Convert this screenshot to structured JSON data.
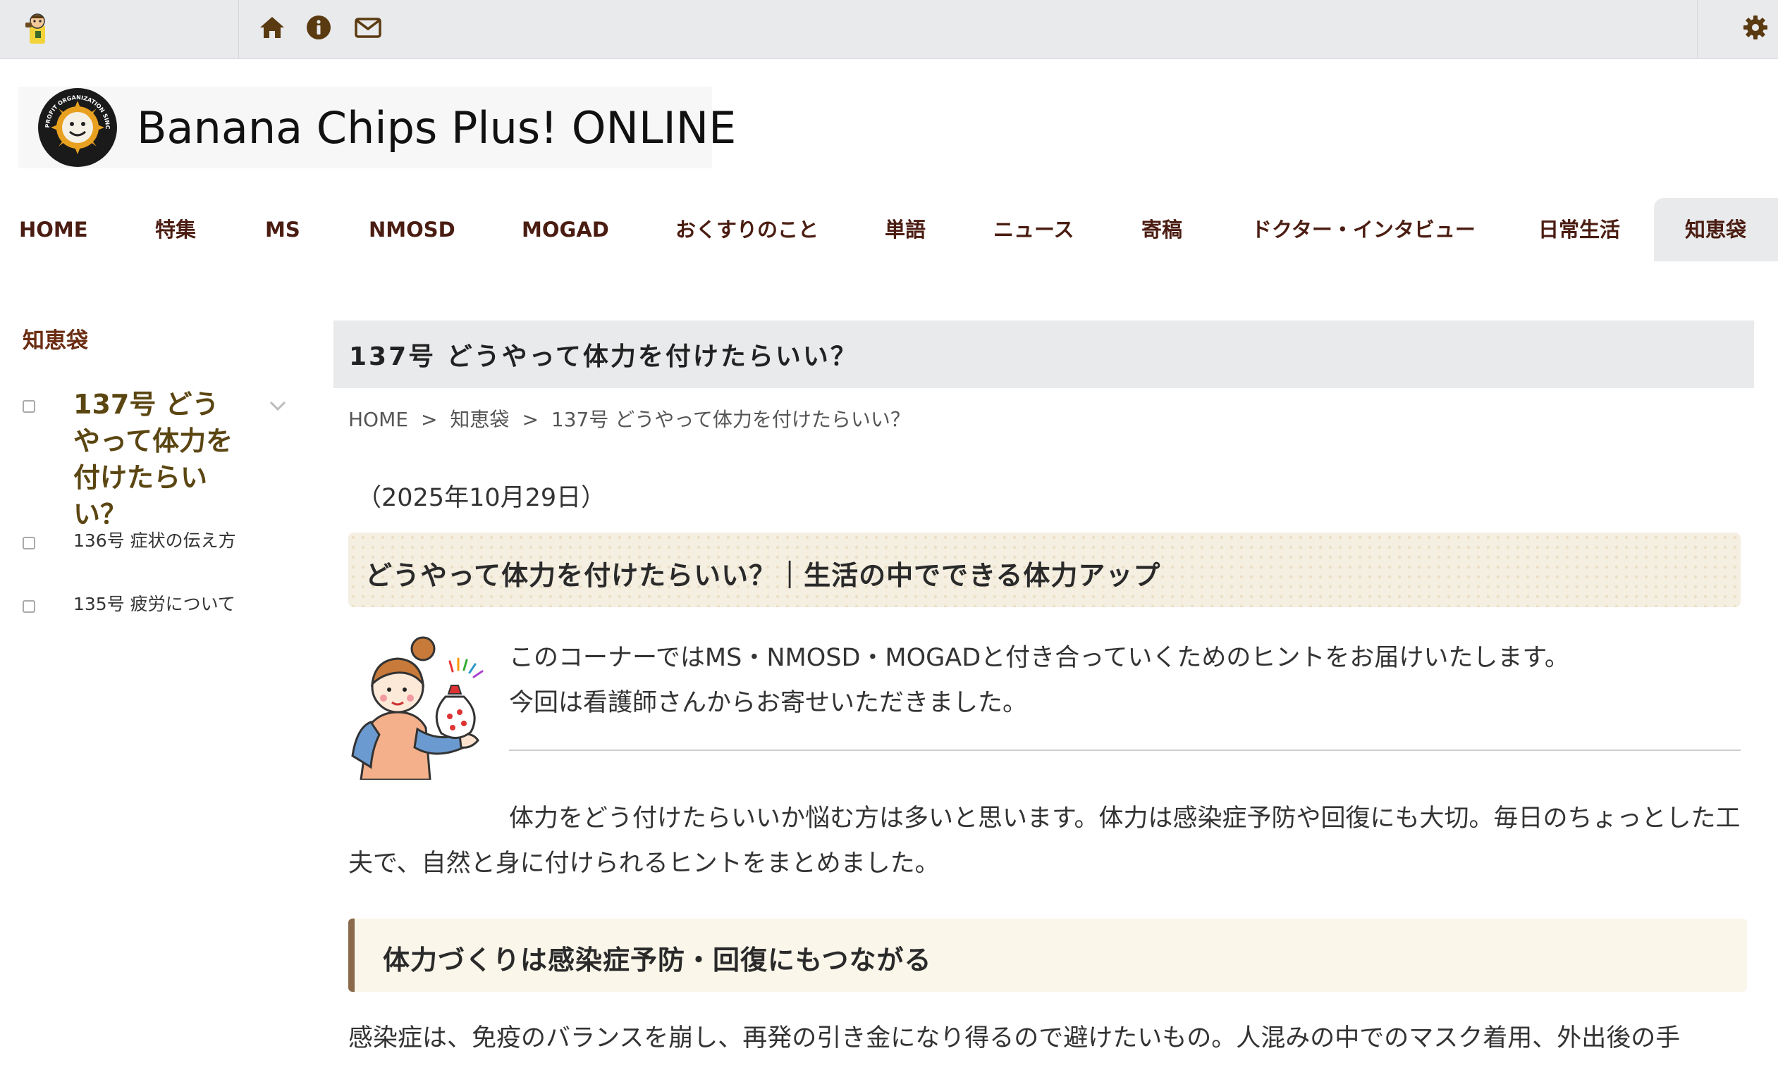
{
  "topbar": {
    "icons": [
      "mascot-icon",
      "home-icon",
      "info-icon",
      "mail-icon",
      "gear-icon"
    ]
  },
  "brand": {
    "title": "Banana Chips Plus! ONLINE",
    "logo_ring_text": "A NON-PROFIT ORGANIZATION SINCE 1998"
  },
  "nav": {
    "items": [
      "HOME",
      "特集",
      "MS",
      "NMOSD",
      "MOGAD",
      "おくすりのこと",
      "単語",
      "ニュース",
      "寄稿",
      "ドクター・インタビュー",
      "日常生活",
      "知恵袋"
    ],
    "active": "知恵袋"
  },
  "sidebar": {
    "heading": "知恵袋",
    "items": [
      {
        "label": "137号 どうやって体力を付けたらいい？"
      },
      {
        "label": "136号 症状の伝え方"
      },
      {
        "label": "135号 疲労について"
      }
    ]
  },
  "article": {
    "title": "137号 どうやって体力を付けたらいい？",
    "breadcrumb": [
      "HOME",
      "知恵袋",
      "137号 どうやって体力を付けたらいい？"
    ],
    "breadcrumb_sep": ">",
    "date": "（2025年10月29日）",
    "banner": "どうやって体力を付けたらいい？｜生活の中でできる体力アップ",
    "intro_line1": "このコーナーではMS・NMOSD・MOGADと付き合っていくためのヒントをお届けいたします。",
    "intro_line2": "今回は看護師さんからお寄せいただきました。",
    "paragraph": "体力をどう付けたらいいか悩む方は多いと思います。体力は感染症予防や回復にも大切。毎日のちょっとした工夫で、自然と身に付けられるヒントをまとめました。",
    "h2": "体力づくりは感染症予防・回復にもつながる",
    "paragraph2": "感染症は、免疫のバランスを崩し、再発の引き金になり得るので避けたいもの。人混みの中でのマスク着用、外出後の手"
  },
  "colors": {
    "nav_text": "#4b1d12",
    "icon": "#5a3a10",
    "banner_bg": "#f5efe2",
    "h2_bar": "#8a6a4a"
  }
}
